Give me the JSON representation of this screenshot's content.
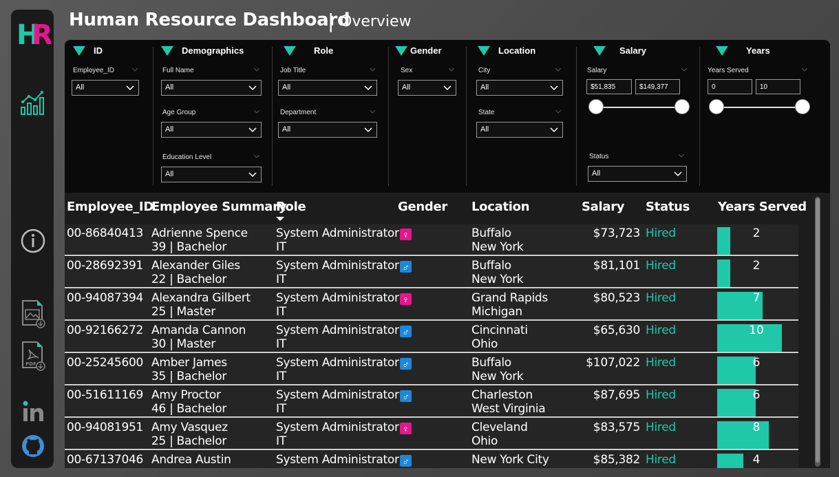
{
  "header": {
    "title": "Human Resource Dashboard",
    "separator": "|",
    "subtitle": "Overview"
  },
  "sidebar": {
    "logo_text": "HR",
    "icons": [
      "chart-icon",
      "info-icon",
      "image-export-icon",
      "pdf-export-icon",
      "linkedin-icon",
      "github-icon"
    ]
  },
  "filters": {
    "id": {
      "heading": "ID",
      "employee_id_label": "Employee_ID",
      "employee_id_value": "All"
    },
    "demographics": {
      "heading": "Demographics",
      "full_name_label": "Full Name",
      "full_name_value": "All",
      "age_group_label": "Age Group",
      "age_group_value": "All",
      "education_label": "Education Level",
      "education_value": "All"
    },
    "role": {
      "heading": "Role",
      "job_title_label": "Job Title",
      "job_title_value": "All",
      "department_label": "Department",
      "department_value": "All"
    },
    "gender": {
      "heading": "Gender",
      "sex_label": "Sex",
      "sex_value": "All"
    },
    "location": {
      "heading": "Location",
      "city_label": "City",
      "city_value": "All",
      "state_label": "State",
      "state_value": "All"
    },
    "salary": {
      "heading": "Salary",
      "salary_label": "Salary",
      "min": "$51,835",
      "max": "$149,377",
      "status_label": "Status",
      "status_value": "All"
    },
    "years": {
      "heading": "Years",
      "years_served_label": "Years Served",
      "min": "0",
      "max": "10"
    }
  },
  "table": {
    "columns": [
      "Employee_ID",
      "Employee Summary",
      "Role",
      "Gender",
      "Location",
      "Salary",
      "Status",
      "Years Served"
    ],
    "rows": [
      {
        "id": "00-86840413",
        "name": "Adrienne Spence",
        "summary": "39 | Bachelor",
        "title": "System Administrator",
        "dept": "IT",
        "gender": "F",
        "city": "Buffalo",
        "state": "New York",
        "salary": "$73,723",
        "status": "Hired",
        "years": 2
      },
      {
        "id": "00-28692391",
        "name": "Alexander Giles",
        "summary": "22 | Bachelor",
        "title": "System Administrator",
        "dept": "IT",
        "gender": "M",
        "city": "Buffalo",
        "state": "New York",
        "salary": "$81,101",
        "status": "Hired",
        "years": 2
      },
      {
        "id": "00-94087394",
        "name": "Alexandra Gilbert",
        "summary": "25 | Master",
        "title": "System Administrator",
        "dept": "IT",
        "gender": "F",
        "city": "Grand Rapids",
        "state": "Michigan",
        "salary": "$80,523",
        "status": "Hired",
        "years": 7
      },
      {
        "id": "00-92166272",
        "name": "Amanda Cannon",
        "summary": "30 | Master",
        "title": "System Administrator",
        "dept": "IT",
        "gender": "M",
        "city": "Cincinnati",
        "state": "Ohio",
        "salary": "$65,630",
        "status": "Hired",
        "years": 10
      },
      {
        "id": "00-25245600",
        "name": "Amber James",
        "summary": "35 | Bachelor",
        "title": "System Administrator",
        "dept": "IT",
        "gender": "M",
        "city": "Buffalo",
        "state": "New York",
        "salary": "$107,022",
        "status": "Hired",
        "years": 6
      },
      {
        "id": "00-51611169",
        "name": "Amy Proctor",
        "summary": "46 | Bachelor",
        "title": "System Administrator",
        "dept": "IT",
        "gender": "M",
        "city": "Charleston",
        "state": "West Virginia",
        "salary": "$87,695",
        "status": "Hired",
        "years": 6
      },
      {
        "id": "00-94081951",
        "name": "Amy Vasquez",
        "summary": "25 | Bachelor",
        "title": "System Administrator",
        "dept": "IT",
        "gender": "F",
        "city": "Cleveland",
        "state": "Ohio",
        "salary": "$83,575",
        "status": "Hired",
        "years": 8
      },
      {
        "id": "00-67137046",
        "name": "Andrea Austin",
        "summary": "",
        "title": "System Administrator",
        "dept": "",
        "gender": "M",
        "city": "New York City",
        "state": "",
        "salary": "$85,382",
        "status": "Hired",
        "years": 4
      }
    ]
  },
  "colors": {
    "accent": "#1fc8a8",
    "female": "#e5168d",
    "male": "#1e88d8"
  }
}
